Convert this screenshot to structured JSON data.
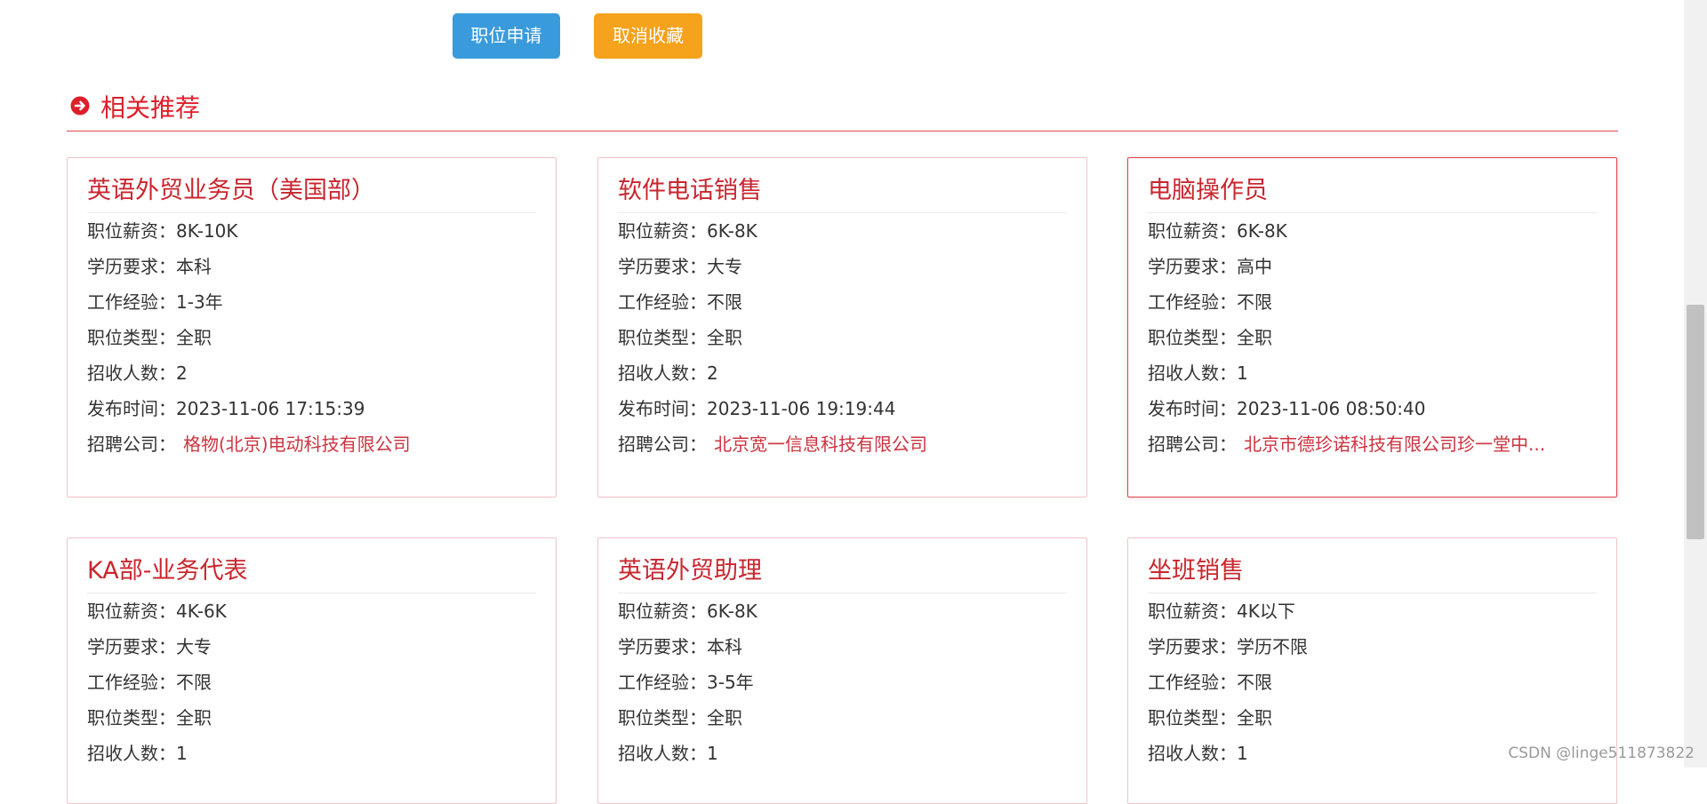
{
  "actions": {
    "apply_label": "职位申请",
    "cancel_favorite_label": "取消收藏"
  },
  "section": {
    "title": "相关推荐",
    "icon": "circle-arrow-right-icon",
    "accent": "#dd1f2b"
  },
  "labels": {
    "salary": "职位薪资：",
    "education": "学历要求：",
    "experience": "工作经验：",
    "job_type": "职位类型：",
    "headcount": "招收人数：",
    "published": "发布时间：",
    "company": "招聘公司："
  },
  "jobs": [
    {
      "title": "英语外贸业务员（美国部）",
      "salary": "8K-10K",
      "education": "本科",
      "experience": "1-3年",
      "job_type": "全职",
      "headcount": "2",
      "published": "2023-11-06 17:15:39",
      "company": "格物(北京)电动科技有限公司"
    },
    {
      "title": "软件电话销售",
      "salary": "6K-8K",
      "education": "大专",
      "experience": "不限",
      "job_type": "全职",
      "headcount": "2",
      "published": "2023-11-06 19:19:44",
      "company": "北京宽一信息科技有限公司"
    },
    {
      "title": "电脑操作员",
      "salary": "6K-8K",
      "education": "高中",
      "experience": "不限",
      "job_type": "全职",
      "headcount": "1",
      "published": "2023-11-06 08:50:40",
      "company": "北京市德珍诺科技有限公司珍一堂中..."
    },
    {
      "title": "KA部-业务代表",
      "salary": "4K-6K",
      "education": "大专",
      "experience": "不限",
      "job_type": "全职",
      "headcount": "1"
    },
    {
      "title": "英语外贸助理",
      "salary": "6K-8K",
      "education": "本科",
      "experience": "3-5年",
      "job_type": "全职",
      "headcount": "1"
    },
    {
      "title": "坐班销售",
      "salary": "4K以下",
      "education": "学历不限",
      "experience": "不限",
      "job_type": "全职",
      "headcount": "1"
    }
  ],
  "watermark": "CSDN @linge511873822"
}
